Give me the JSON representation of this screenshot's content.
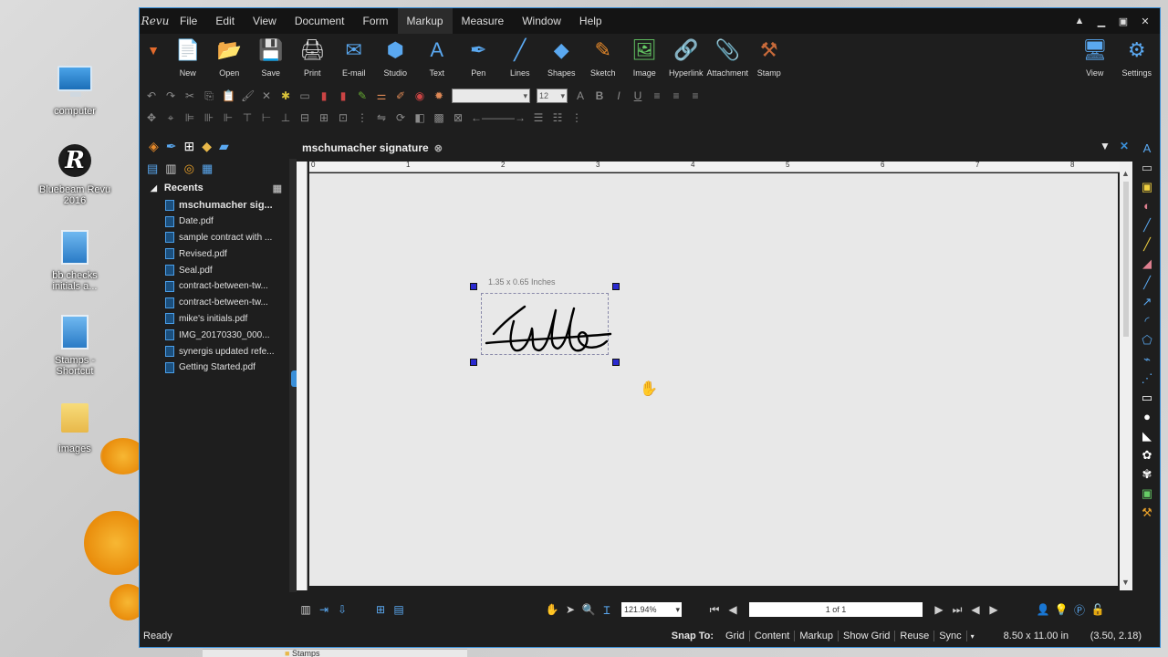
{
  "desktop": {
    "icons": [
      {
        "label": "computer",
        "type": "monitor"
      },
      {
        "label": "Bluebeam Revu 2016",
        "type": "revu"
      },
      {
        "label": "bb checks initials a...",
        "type": "file"
      },
      {
        "label": "Stamps - Shortcut",
        "type": "file"
      },
      {
        "label": "images",
        "type": "folder"
      }
    ]
  },
  "app": {
    "logo": "Revu",
    "menu": [
      "File",
      "Edit",
      "View",
      "Document",
      "Form",
      "Markup",
      "Measure",
      "Window",
      "Help"
    ],
    "active_menu": "Markup",
    "ribbon": [
      {
        "label": "New",
        "icon": "new-document-icon",
        "glyph": "📄"
      },
      {
        "label": "Open",
        "icon": "open-folder-icon",
        "glyph": "📂"
      },
      {
        "label": "Save",
        "icon": "save-icon",
        "glyph": "💾"
      },
      {
        "label": "Print",
        "icon": "print-icon",
        "glyph": "🖨"
      },
      {
        "label": "E-mail",
        "icon": "email-icon",
        "glyph": "✉"
      },
      {
        "label": "Studio",
        "icon": "studio-icon",
        "glyph": "⬢"
      },
      {
        "label": "Text",
        "icon": "text-icon",
        "glyph": "A"
      },
      {
        "label": "Pen",
        "icon": "pen-icon",
        "glyph": "✒"
      },
      {
        "label": "Lines",
        "icon": "lines-icon",
        "glyph": "╱"
      },
      {
        "label": "Shapes",
        "icon": "shapes-icon",
        "glyph": "◆"
      },
      {
        "label": "Sketch",
        "icon": "sketch-icon",
        "glyph": "✎"
      },
      {
        "label": "Image",
        "icon": "image-icon",
        "glyph": "🖼"
      },
      {
        "label": "Hyperlink",
        "icon": "hyperlink-icon",
        "glyph": "🔗"
      },
      {
        "label": "Attachment",
        "icon": "attachment-icon",
        "glyph": "📎"
      },
      {
        "label": "Stamp",
        "icon": "stamp-icon",
        "glyph": "⚒"
      }
    ],
    "ribbon_right": [
      {
        "label": "View",
        "icon": "view-monitor-icon",
        "glyph": "🖥"
      },
      {
        "label": "Settings",
        "icon": "settings-icon",
        "glyph": "⚙"
      }
    ],
    "font_size": "12",
    "document_tab": "mschumacher signature",
    "recents_header": "Recents",
    "recents": [
      "mschumacher sig...",
      "Date.pdf",
      "sample contract with ...",
      "Revised.pdf",
      "Seal.pdf",
      "contract-between-tw...",
      "contract-between-tw...",
      "mike's initials.pdf",
      "IMG_20170330_000...",
      "synergis updated refe...",
      "Getting Started.pdf"
    ],
    "ruler_numbers": [
      "0",
      "1",
      "2",
      "3",
      "4",
      "5",
      "6",
      "7",
      "8"
    ],
    "signature_dimensions": "1.35 x 0.65 Inches",
    "zoom": "121.94%",
    "page_indicator": "1 of 1",
    "status": {
      "ready": "Ready",
      "snap_to": "Snap To:",
      "snap_items": [
        "Grid",
        "Content",
        "Markup",
        "Show Grid",
        "Reuse",
        "Sync"
      ],
      "page_size": "8.50 x 11.00 in",
      "coords": "(3.50, 2.18)"
    }
  },
  "taskbar": {
    "label": "Stamps"
  },
  "colors": {
    "accent": "#3a8fd8",
    "handle": "#2a2ad0",
    "app_bg": "#1e1e1e"
  }
}
